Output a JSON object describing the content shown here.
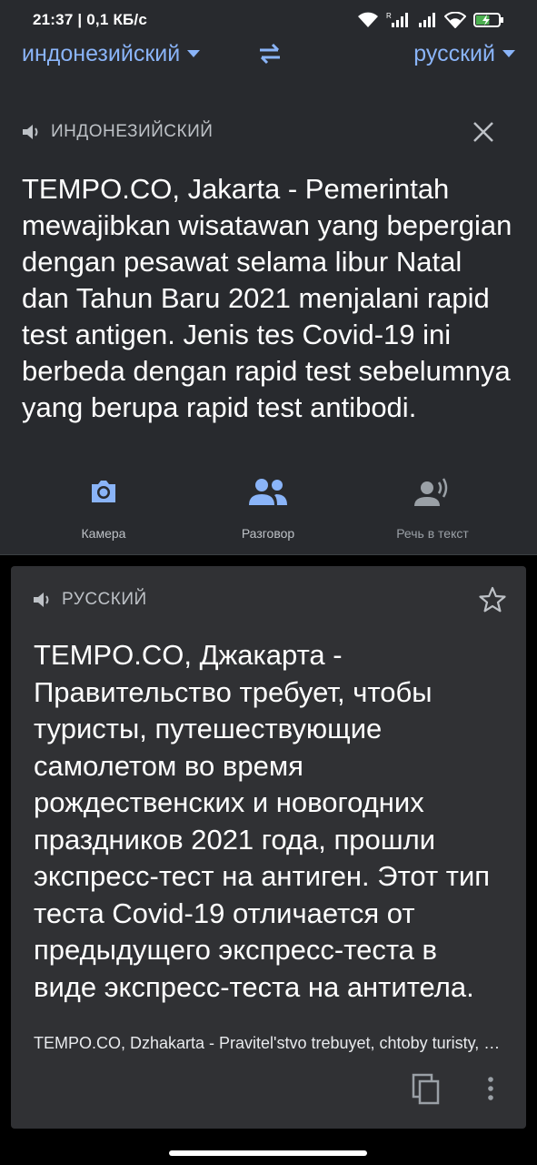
{
  "status_bar": {
    "time_speed": "21:37 | 0,1 КБ/с",
    "battery_level": 0.6
  },
  "language_bar": {
    "source_language": "индонезийский",
    "target_language": "русский"
  },
  "source_panel": {
    "label": "ИНДОНЕЗИЙСКИЙ",
    "text": "TEMPO.CO, Jakarta - Pemerintah mewajibkan wisatawan yang bepergian dengan pesawat selama libur Natal dan Tahun Baru 2021 menjalani rapid test antigen. Jenis tes Covid-19 ini berbeda dengan rapid test sebelumnya yang berupa rapid test antibodi."
  },
  "tools": {
    "camera_label": "Камера",
    "conversation_label": "Разговор",
    "speech_label": "Речь в текст"
  },
  "result_panel": {
    "label": "РУССКИЙ",
    "text": "TEMPO.CO, Джакарта - Правительство требует, чтобы туристы, путешествующие самолетом во время рождественских и новогодних праздников 2021 года, прошли экспресс-тест на антиген.  Этот тип теста Covid-19 отличается от предыдущего экспресс-теста в виде экспресс-теста на антитела.",
    "transliteration": "TEMPO.CO, Dzhakarta - Pravitel'stvo trebuyet, chtoby turisty, puteshestvuyushchiye samoletom vo vremya"
  },
  "colors": {
    "accent": "#8ab4f8",
    "panel_bg": "#282a2e",
    "card_bg": "#303134"
  },
  "icons": {
    "speaker": "speaker-icon",
    "close": "close-icon",
    "camera": "camera-icon",
    "conversation": "people-icon",
    "speech": "voice-icon",
    "star": "star-icon",
    "copy": "copy-icon",
    "more": "more-vert-icon",
    "swap": "swap-icon"
  }
}
